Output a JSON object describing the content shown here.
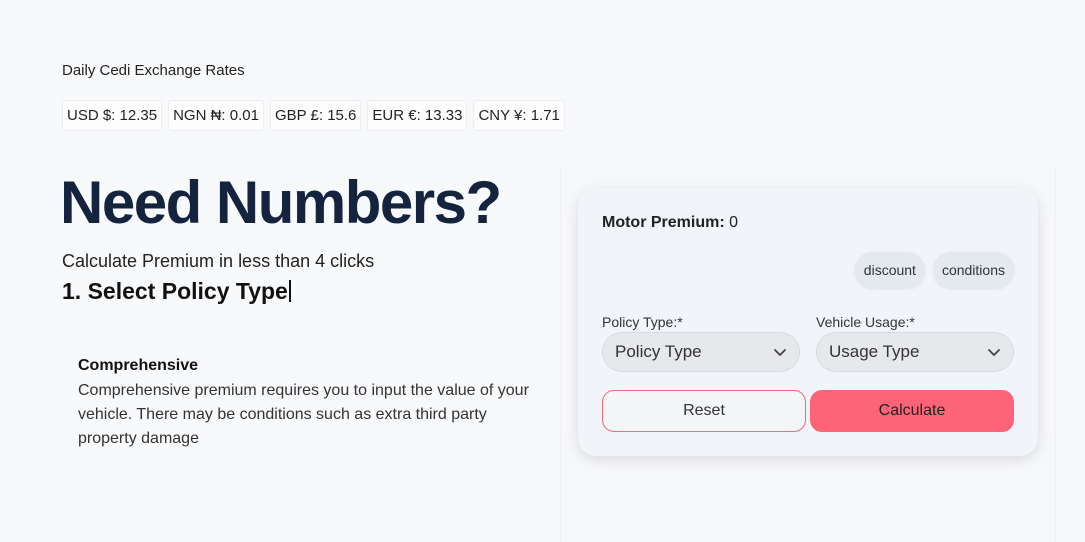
{
  "rates": {
    "title": "Daily Cedi Exchange Rates",
    "items": [
      {
        "label": "USD $: 12.35"
      },
      {
        "label": "NGN ₦: 0.01"
      },
      {
        "label": "GBP £: 15.6"
      },
      {
        "label": "EUR €: 13.33"
      },
      {
        "label": "CNY ¥: 1.71"
      }
    ]
  },
  "hero": {
    "headline": "Need Numbers?",
    "subhead": "Calculate Premium in less than 4 clicks",
    "step": "1. Select Policy Type"
  },
  "info": {
    "title": "Comprehensive",
    "text": "Comprehensive premium requires you to input the value of your vehicle. There may be conditions such as extra third party property damage"
  },
  "calculator": {
    "premium_label": "Motor Premium:",
    "premium_value": "0",
    "chips": {
      "discount": "discount",
      "conditions": "conditions"
    },
    "policy_label": "Policy Type:*",
    "policy_value": "Policy Type",
    "usage_label": "Vehicle Usage:*",
    "usage_value": "Usage Type",
    "reset_label": "Reset",
    "calculate_label": "Calculate"
  },
  "colors": {
    "accent": "#ff6377",
    "headline": "#14233e",
    "card_bg": "#f1f4f8"
  }
}
